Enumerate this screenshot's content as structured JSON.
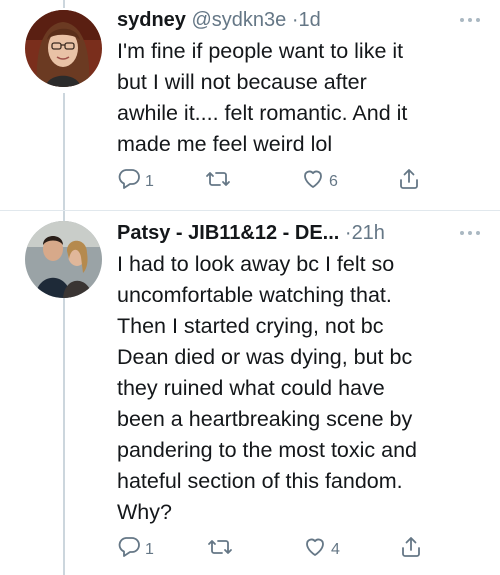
{
  "tweets": [
    {
      "display_name": "sydney",
      "handle": "@sydkn3e",
      "separator": "·",
      "time": "1d",
      "text": "I'm fine if people want to like it\nbut I will not because after\nawhile it.... felt romantic. And it\nmade me feel weird lol",
      "reply_count": "1",
      "retweet_count": "",
      "like_count": "6"
    },
    {
      "display_name": "Patsy - JIB11&12 - DE...",
      "handle": "",
      "separator": "·",
      "time": "21h",
      "text": "I had to look away bc I felt so\nuncomfortable watching that.\nThen I started crying, not bc\nDean died or was dying, but bc\nthey ruined what could have\nbeen a heartbreaking scene by\npandering to the most toxic and\nhateful section of this fandom.\nWhy?",
      "reply_count": "1",
      "retweet_count": "",
      "like_count": "4"
    }
  ],
  "colors": {
    "text": "#14171a",
    "secondary": "#657786",
    "thread_line": "#ccd6dd"
  },
  "icons": [
    "reply-icon",
    "retweet-icon",
    "like-icon",
    "share-icon",
    "more-icon"
  ]
}
